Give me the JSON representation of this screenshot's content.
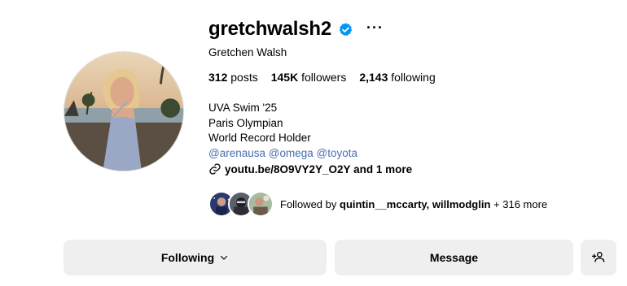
{
  "profile": {
    "username": "gretchwalsh2",
    "more_label": "···",
    "full_name": "Gretchen Walsh",
    "stats": {
      "posts_count": "312",
      "posts_label": "posts",
      "followers_count": "145K",
      "followers_label": "followers",
      "following_count": "2,143",
      "following_label": "following"
    },
    "bio": {
      "line1": "UVA Swim '25",
      "line2": "Paris Olympian",
      "line3": "World Record Holder",
      "mentions": [
        "@arenausa",
        "@omega",
        "@toyota"
      ]
    },
    "link_text": "youtu.be/8O9VY2Y_O2Y and 1 more",
    "followed_by": {
      "prefix": "Followed by",
      "user1": "quintin__mccarty,",
      "user2": "willmodglin",
      "suffix": "+ 316 more"
    }
  },
  "actions": {
    "following_label": "Following",
    "message_label": "Message"
  },
  "icons": {
    "verified": "verified-badge-icon",
    "link": "link-icon",
    "chevron": "chevron-down-icon",
    "add_user": "add-user-icon"
  },
  "colors": {
    "verified_blue": "#0095f6",
    "mention_blue": "#4a6fb0",
    "button_bg": "#efefef"
  }
}
